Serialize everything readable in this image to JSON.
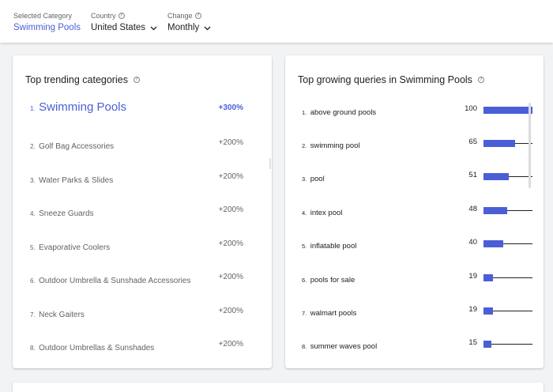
{
  "filters": {
    "category": {
      "label": "Selected Category",
      "value": "Swimming Pools"
    },
    "country": {
      "label": "Country",
      "value": "United States"
    },
    "change": {
      "label": "Change",
      "value": "Monthly"
    }
  },
  "left_card": {
    "title": "Top trending categories",
    "items": [
      {
        "rank": "1.",
        "name": "Swimming Pools",
        "change": "+300%"
      },
      {
        "rank": "2.",
        "name": "Golf Bag Accessories",
        "change": "+200%"
      },
      {
        "rank": "3.",
        "name": "Water Parks & Slides",
        "change": "+200%"
      },
      {
        "rank": "4.",
        "name": "Sneeze Guards",
        "change": "+200%"
      },
      {
        "rank": "5.",
        "name": "Evaporative Coolers",
        "change": "+200%"
      },
      {
        "rank": "6.",
        "name": "Outdoor Umbrella & Sunshade Accessories",
        "change": "+200%"
      },
      {
        "rank": "7.",
        "name": "Neck Gaiters",
        "change": "+200%"
      },
      {
        "rank": "8.",
        "name": "Outdoor Umbrellas & Sunshades",
        "change": "+200%"
      }
    ]
  },
  "right_card": {
    "title": "Top growing queries in Swimming Pools",
    "max_value": 100,
    "items": [
      {
        "rank": "1.",
        "name": "above ground pools",
        "value": "100",
        "level": 100
      },
      {
        "rank": "2.",
        "name": "swimming pool",
        "value": "65",
        "level": 65
      },
      {
        "rank": "3.",
        "name": "pool",
        "value": "51",
        "level": 51
      },
      {
        "rank": "4.",
        "name": "intex pool",
        "value": "48",
        "level": 48
      },
      {
        "rank": "5.",
        "name": "inflatable pool",
        "value": "40",
        "level": 40
      },
      {
        "rank": "6.",
        "name": "pools for sale",
        "value": "19",
        "level": 19
      },
      {
        "rank": "7.",
        "name": "walmart pools",
        "value": "19",
        "level": 19
      },
      {
        "rank": "8.",
        "name": "summer waves pool",
        "value": "15",
        "level": 15
      }
    ]
  },
  "colors": {
    "accent": "#4a5fd6",
    "bar": "#4a5fd6"
  },
  "icons": [
    "help-icon",
    "chevron-down-icon"
  ]
}
